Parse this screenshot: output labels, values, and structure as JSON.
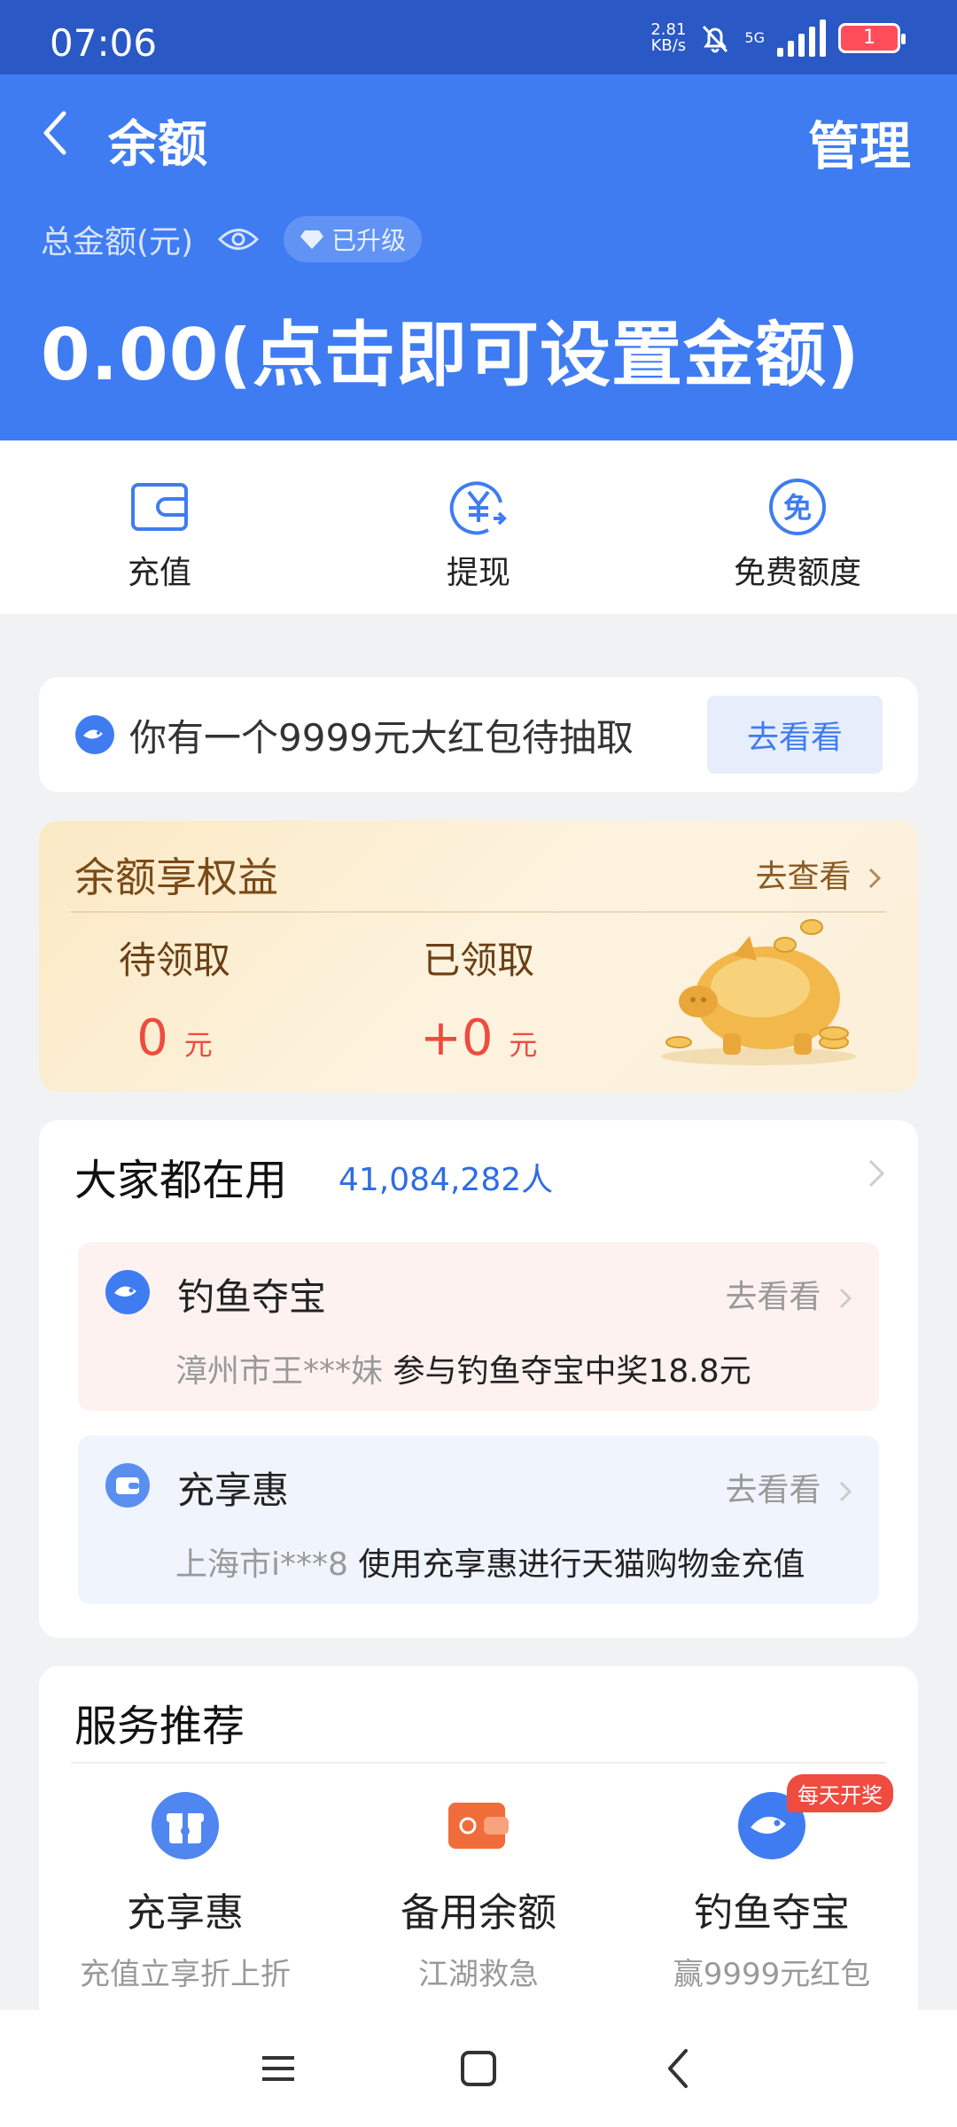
{
  "status_bar": {
    "time": "07:06",
    "speed_value": "2.81",
    "speed_unit": "KB/s",
    "network": "5G",
    "battery": "1"
  },
  "nav": {
    "title": "余额",
    "manage": "管理"
  },
  "balance": {
    "total_label": "总金额(元)",
    "upgrade_badge": "已升级",
    "amount": "0.00(点击即可设置金额)"
  },
  "quick_actions": [
    {
      "label": "充值",
      "icon": "wallet-icon"
    },
    {
      "label": "提现",
      "icon": "yuan-transfer-icon"
    },
    {
      "label": "免费额度",
      "icon": "free-quota-icon"
    }
  ],
  "hongbao": {
    "text": "你有一个9999元大红包待抽取",
    "button": "去看看"
  },
  "benefits": {
    "title": "余额享权益",
    "more": "去查看",
    "pending_label": "待领取",
    "pending_value": "0",
    "pending_unit": "元",
    "claimed_label": "已领取",
    "claimed_value": "+0",
    "claimed_unit": "元"
  },
  "popular": {
    "title": "大家都在用",
    "count": "41,084,282人",
    "items": [
      {
        "title": "钓鱼夺宝",
        "go": "去看看",
        "user": "漳州市王***妹",
        "desc": "参与钓鱼夺宝中奖18.8元"
      },
      {
        "title": "充享惠",
        "go": "去看看",
        "user": "上海市i***8",
        "desc": "使用充享惠进行天猫购物金充值"
      }
    ]
  },
  "services": {
    "title": "服务推荐",
    "items": [
      {
        "title": "充享惠",
        "subtitle": "充值立享折上折"
      },
      {
        "title": "备用余额",
        "subtitle": "江湖救急"
      },
      {
        "title": "钓鱼夺宝",
        "subtitle": "赢9999元红包",
        "badge": "每天开奖"
      }
    ]
  },
  "colors": {
    "header_blue": "#3f7cf2",
    "status_blue": "#2a58c4",
    "accent_red": "#ef4b3f",
    "link_blue": "#2f6de3"
  }
}
